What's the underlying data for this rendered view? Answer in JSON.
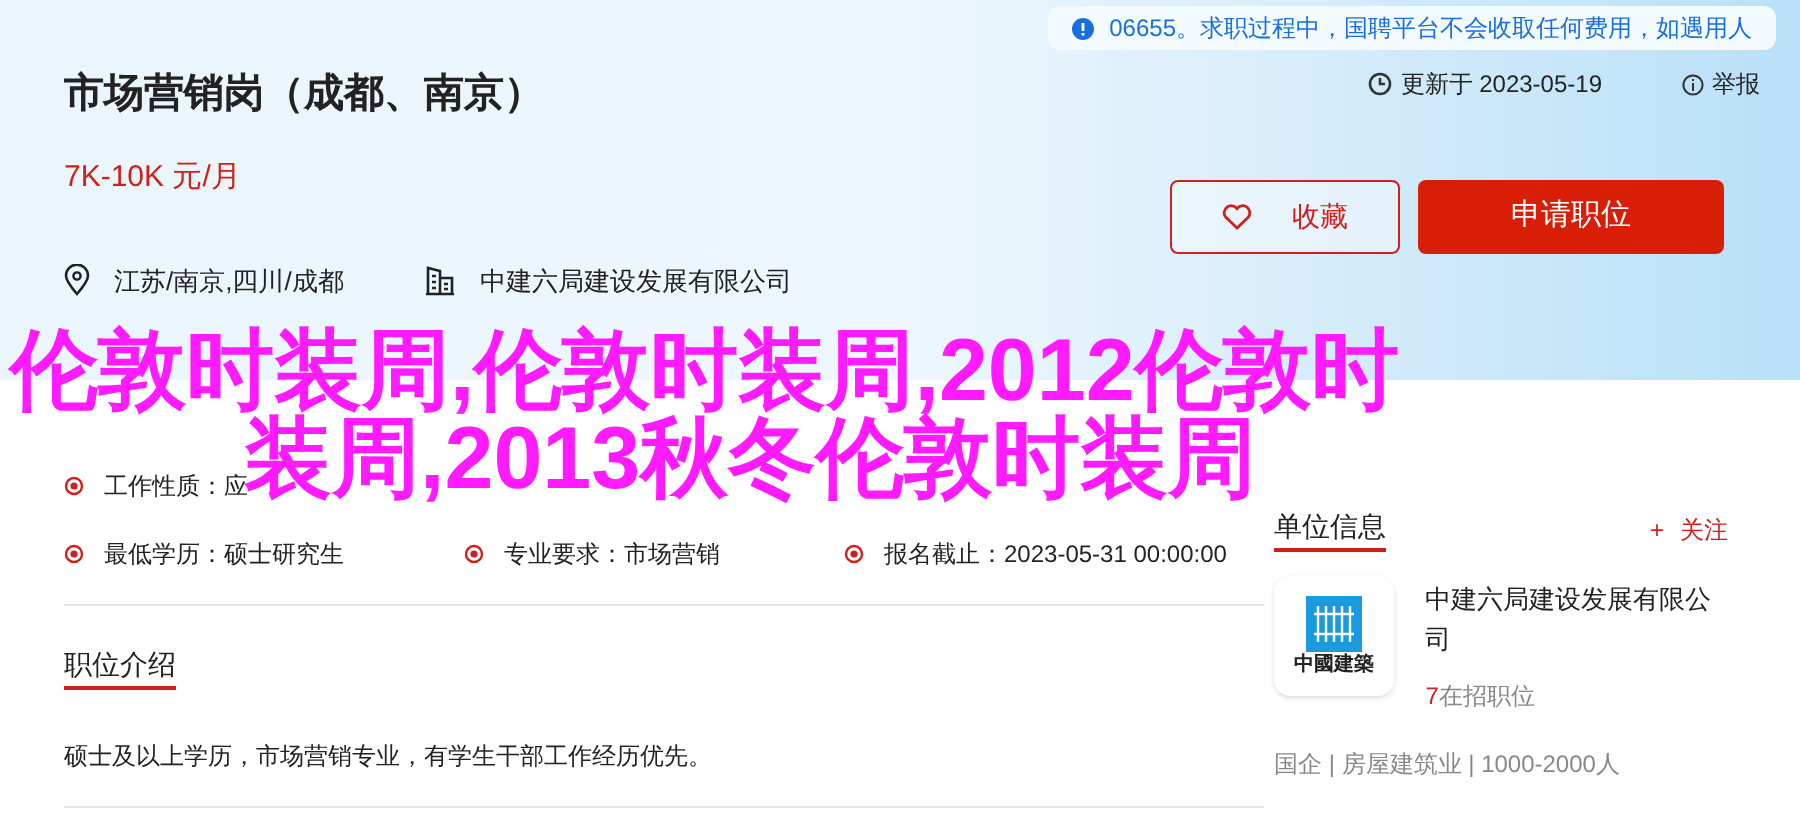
{
  "notice": {
    "text": "06655。求职过程中，国聘平台不会收取任何费用，如遇用人"
  },
  "job": {
    "title": "市场营销岗（成都、南京）",
    "salary": "7K-10K 元/月",
    "location": "江苏/南京,四川/成都",
    "company": "中建六局建设发展有限公司",
    "updated": "更新于 2023-05-19",
    "report": "举报"
  },
  "buttons": {
    "favorite": "收藏",
    "apply": "申请职位"
  },
  "attributes": [
    {
      "label": "工作性质：",
      "value": "应"
    },
    {
      "label": "最低学历：",
      "value": "硕士研究生"
    },
    {
      "label": "专业要求：",
      "value": "市场营销"
    },
    {
      "label": "报名截止：",
      "value": "2023-05-31 00:00:00"
    }
  ],
  "intro": {
    "heading": "职位介绍",
    "text": "硕士及以上学历，市场营销专业，有学生干部工作经历优先。"
  },
  "company_info": {
    "heading": "单位信息",
    "follow": "关注",
    "follow_icon": "+",
    "name": "中建六局建设发展有限公司",
    "logo_text": "中國建築",
    "open_count": "7",
    "open_label": "在招职位",
    "meta": "国企 | 房屋建筑业 | 1000-2000人"
  },
  "overlay": {
    "lines": [
      "伦敦时装周,伦敦时装周,2012伦敦时",
      "装周,2013秋冬伦敦时装周"
    ]
  }
}
